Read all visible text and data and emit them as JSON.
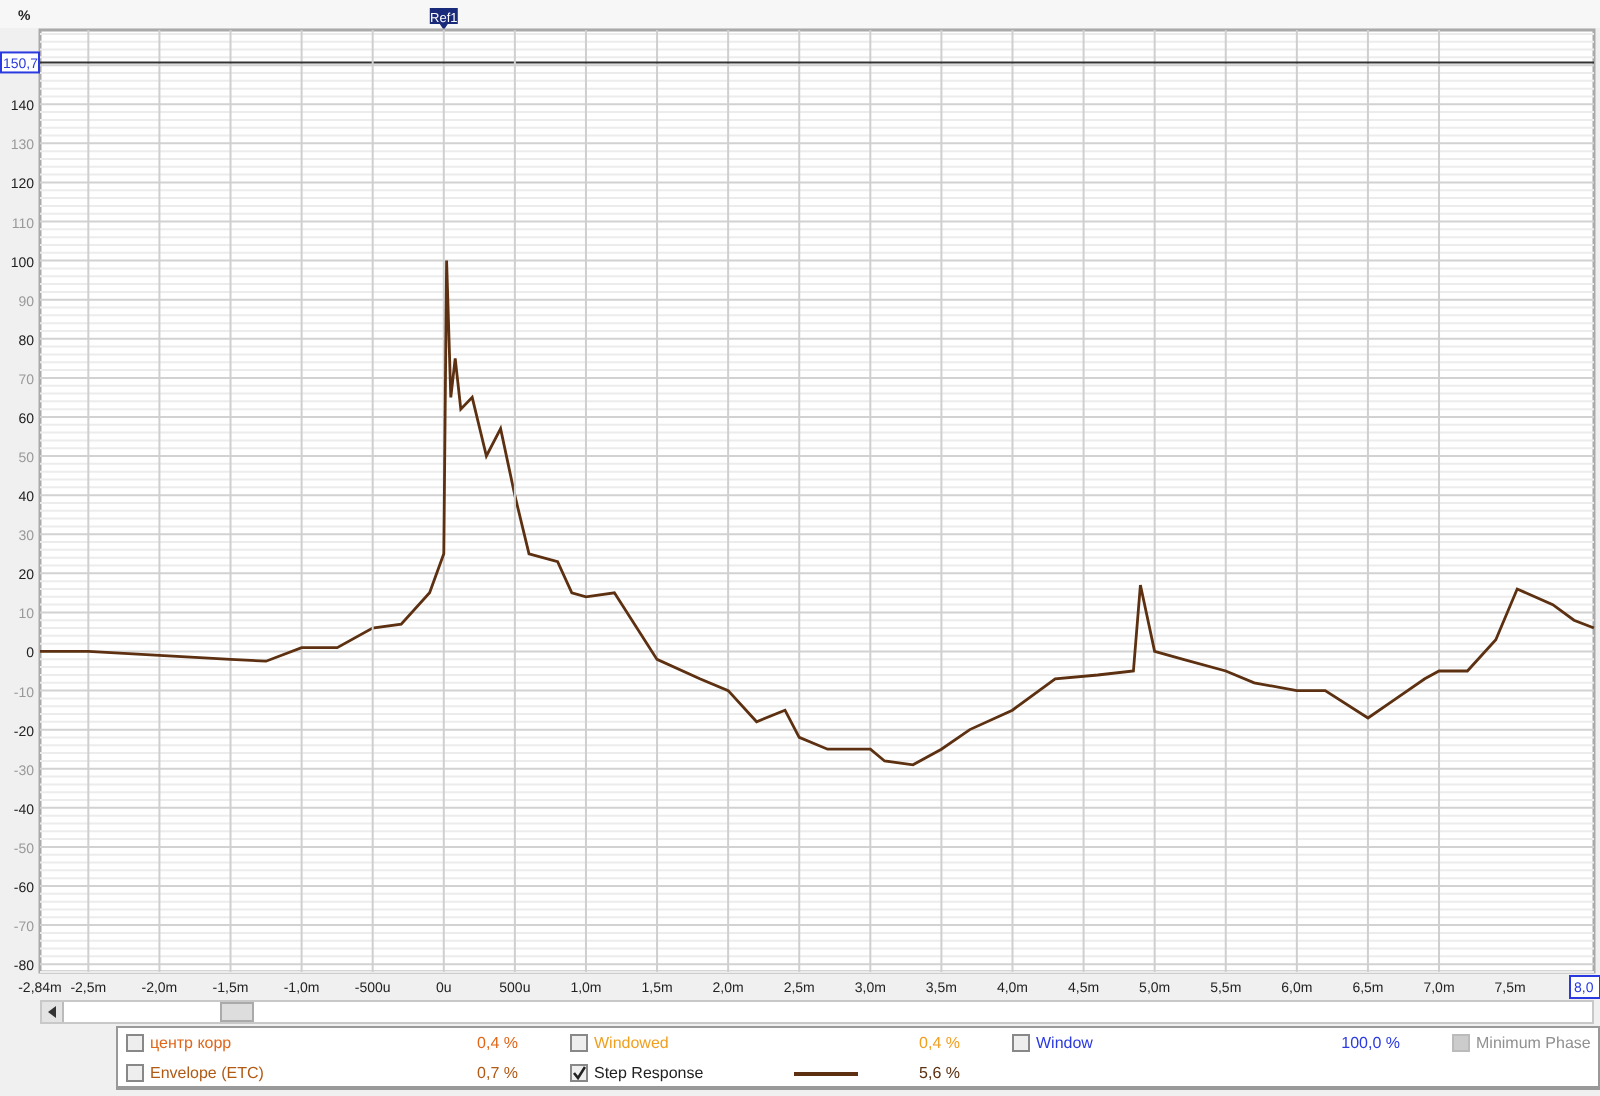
{
  "ruler": {
    "unit": "%",
    "marker": "Ref1"
  },
  "chart_data": {
    "type": "line",
    "x": [
      -2.84,
      -2.5,
      -2.0,
      -1.5,
      -1.25,
      -1.0,
      -0.75,
      -0.5,
      -0.3,
      -0.1,
      0,
      0.02,
      0.05,
      0.08,
      0.12,
      0.2,
      0.3,
      0.4,
      0.5,
      0.6,
      0.8,
      0.9,
      1.0,
      1.2,
      1.5,
      1.8,
      2.0,
      2.2,
      2.4,
      2.5,
      2.7,
      3.0,
      3.1,
      3.3,
      3.5,
      3.7,
      4.0,
      4.3,
      4.6,
      4.85,
      4.9,
      5.0,
      5.2,
      5.5,
      5.7,
      6.0,
      6.2,
      6.5,
      6.7,
      6.9,
      7.0,
      7.2,
      7.4,
      7.55,
      7.8,
      7.95,
      8.09
    ],
    "series": [
      {
        "name": "Step Response",
        "color": "#5c3010",
        "values": [
          0,
          0,
          -1,
          -2,
          -2.5,
          1,
          1,
          6,
          7,
          15,
          25,
          100,
          65,
          75,
          62,
          65,
          50,
          57,
          40,
          25,
          23,
          15,
          14,
          15,
          -2,
          -7,
          -10,
          -18,
          -15,
          -22,
          -25,
          -25,
          -28,
          -29,
          -25,
          -20,
          -15,
          -7,
          -6,
          -5,
          17,
          0,
          -2,
          -5,
          -8,
          -10,
          -10,
          -17,
          -12,
          -7,
          -5,
          -5,
          3,
          16,
          12,
          8,
          6
        ]
      }
    ],
    "xlim": [
      -2.84,
      8.09
    ],
    "ylim": [
      -82,
      159
    ],
    "xticks": [
      {
        "value": -2.84,
        "label": "-2,84m"
      },
      {
        "value": -2.5,
        "label": "-2,5m"
      },
      {
        "value": -2.0,
        "label": "-2,0m"
      },
      {
        "value": -1.5,
        "label": "-1,5m"
      },
      {
        "value": -1.0,
        "label": "-1,0m"
      },
      {
        "value": 0,
        "label": "0u"
      },
      {
        "value": 1.0,
        "label": "1,0m"
      },
      {
        "value": 1.5,
        "label": "1,5m"
      },
      {
        "value": 2.0,
        "label": "2,0m"
      },
      {
        "value": 2.5,
        "label": "2,5m"
      },
      {
        "value": 3.0,
        "label": "3,0m"
      },
      {
        "value": 3.5,
        "label": "3,5m"
      },
      {
        "value": 4.0,
        "label": "4,0m"
      },
      {
        "value": 4.5,
        "label": "4,5m"
      },
      {
        "value": 5.0,
        "label": "5,0m"
      },
      {
        "value": 5.5,
        "label": "5,5m"
      },
      {
        "value": 6.0,
        "label": "6,0m"
      },
      {
        "value": 6.5,
        "label": "6,5m"
      },
      {
        "value": 7.0,
        "label": "7,0m"
      },
      {
        "value": 7.5,
        "label": "7,5m"
      }
    ],
    "yticks": [
      -80,
      -70,
      -60,
      -50,
      -40,
      -30,
      -20,
      -10,
      0,
      10,
      20,
      30,
      40,
      50,
      60,
      70,
      80,
      90,
      100,
      110,
      120,
      130,
      140
    ],
    "grid": true,
    "ref_lines": [
      {
        "axis": "y",
        "value": 150.7,
        "label": "150,7"
      }
    ]
  },
  "x_micro_labels": [
    {
      "label": "-500u"
    },
    {
      "label": "500u"
    }
  ],
  "x_cursor": {
    "label": "8,0"
  },
  "legend": {
    "rows": [
      [
        {
          "kind": "option",
          "label": "центр корр",
          "checked": false,
          "disabled": false,
          "value": "0,4 %",
          "color": "#e0661a"
        },
        {
          "kind": "option",
          "label": "Windowed",
          "checked": false,
          "disabled": false,
          "value": "0,4 %",
          "color": "#f0a020"
        },
        {
          "kind": "option",
          "label": "Window",
          "checked": false,
          "disabled": false,
          "value": "100,0 %",
          "color": "#2a3ae0"
        },
        {
          "kind": "option",
          "label": "Minimum Phase",
          "checked": false,
          "disabled": true,
          "color": "#909090"
        }
      ],
      [
        {
          "kind": "option",
          "label": "Envelope (ETC)",
          "checked": false,
          "disabled": false,
          "value": "0,7 %",
          "color": "#b05a14"
        },
        {
          "kind": "series",
          "checked": true,
          "disabled": false,
          "value": "5,6 %"
        }
      ]
    ]
  }
}
